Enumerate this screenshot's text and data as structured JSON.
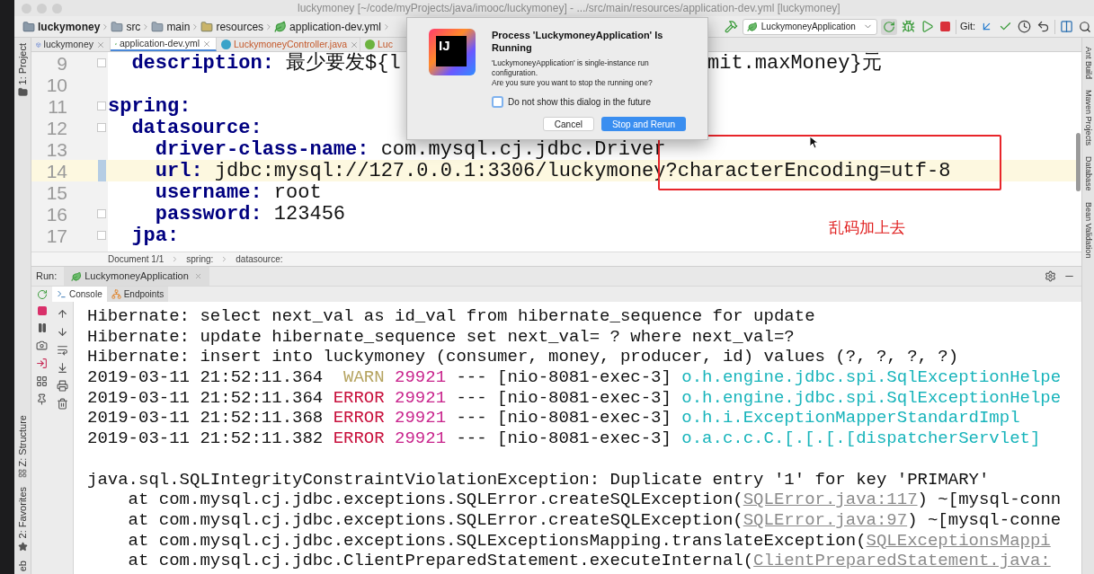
{
  "window": {
    "title": "luckymoney [~/code/myProjects/java/imooc/luckymoney] - .../src/main/resources/application-dev.yml [luckymoney]"
  },
  "breadcrumb": [
    {
      "label": "luckymoney",
      "kind": "project"
    },
    {
      "label": "src",
      "kind": "folder"
    },
    {
      "label": "main",
      "kind": "folder"
    },
    {
      "label": "resources",
      "kind": "resources"
    },
    {
      "label": "application-dev.yml",
      "kind": "yaml"
    }
  ],
  "toolbar": {
    "run_config": "LuckymoneyApplication",
    "git_label": "Git:"
  },
  "left_tool_windows": [
    "1: Project",
    "Z: Structure",
    "2: Favorites",
    "eb"
  ],
  "right_tool_windows": [
    "Ant Build",
    "Maven Projects",
    "Database",
    "Bean Validation"
  ],
  "tabs": [
    {
      "label": "luckymoney",
      "kind": "module",
      "selected": false,
      "error": false
    },
    {
      "label": "application-dev.yml",
      "kind": "yaml",
      "selected": true,
      "error": false
    },
    {
      "label": "LuckymoneyController.java",
      "kind": "class",
      "selected": false,
      "error": true
    },
    {
      "label": "Luc",
      "kind": "interface",
      "selected": false,
      "error": true
    }
  ],
  "editor": {
    "lines": [
      {
        "number": "9",
        "key": "  description:",
        "value": " 最少要发${l",
        "tail": "mit.maxMoney}元",
        "fold": true,
        "current": false
      },
      {
        "number": "10",
        "fold": false,
        "current": false
      },
      {
        "number": "11",
        "key": "spring:",
        "fold": true,
        "current": false
      },
      {
        "number": "12",
        "key": "  datasource:",
        "fold": true,
        "current": false
      },
      {
        "number": "13",
        "key": "    driver-class-name:",
        "value": " com.mysql.cj.jdbc.Driver",
        "fold": false,
        "current": false
      },
      {
        "number": "14",
        "key": "    url:",
        "value": " jdbc:mysql://127.0.0.1:3306/luckymoney",
        "boxed": "?characterEncoding=utf-8",
        "fold": false,
        "current": true
      },
      {
        "number": "15",
        "key": "    username:",
        "value": " root",
        "fold": false,
        "current": false
      },
      {
        "number": "16",
        "key": "    password:",
        "value": " 123456",
        "fold": true,
        "current": false
      },
      {
        "number": "17",
        "key": "  jpa:",
        "fold": true,
        "current": false
      }
    ]
  },
  "annotation": {
    "note": "乱码加上去"
  },
  "editor_breadcrumb": [
    "Document 1/1",
    "spring:",
    "datasource:"
  ],
  "run": {
    "label": "Run:",
    "tab": "LuckymoneyApplication",
    "console_tabs": [
      {
        "label": "Console",
        "kind": "console",
        "selected": true
      },
      {
        "label": "Endpoints",
        "kind": "endpoints",
        "selected": false
      }
    ],
    "lines": [
      {
        "kind": "plain",
        "text": "Hibernate: select next_val as id_val from hibernate_sequence for update"
      },
      {
        "kind": "plain",
        "text": "Hibernate: update hibernate_sequence set next_val= ? where next_val=?"
      },
      {
        "kind": "plain",
        "text": "Hibernate: insert into luckymoney (consumer, money, producer, id) values (?, ?, ?, ?)"
      },
      {
        "kind": "log",
        "timestamp": "2019-03-11 21:52:11.364",
        "level": "WARN",
        "color": "#b5a35f",
        "pid": "29921",
        "thread": "--- [nio-8081-exec-3]",
        "logger": "o.h.engine.jdbc.spi.SqlExceptionHelpe"
      },
      {
        "kind": "log",
        "timestamp": "2019-03-11 21:52:11.364",
        "level": "ERROR",
        "color": "#c8103c",
        "pid": "29921",
        "thread": "--- [nio-8081-exec-3]",
        "logger": "o.h.engine.jdbc.spi.SqlExceptionHelpe"
      },
      {
        "kind": "log",
        "timestamp": "2019-03-11 21:52:11.368",
        "level": "ERROR",
        "color": "#c8103c",
        "pid": "29921",
        "thread": "--- [nio-8081-exec-3]",
        "logger": "o.h.i.ExceptionMapperStandardImpl"
      },
      {
        "kind": "log",
        "timestamp": "2019-03-11 21:52:11.382",
        "level": "ERROR",
        "color": "#c8103c",
        "pid": "29921",
        "thread": "--- [nio-8081-exec-3]",
        "logger": "o.a.c.c.C.[.[.[.[dispatcherServlet]"
      },
      {
        "kind": "blank"
      },
      {
        "kind": "exception",
        "text": "java.sql.SQLIntegrityConstraintViolationException: Duplicate entry '1' for key 'PRIMARY'",
        "frames": [
          {
            "text": "at com.mysql.cj.jdbc.exceptions.SQLError.createSQLException(",
            "link": "SQLError.java:117",
            "suffix": ") ~[mysql-conn"
          },
          {
            "text": "at com.mysql.cj.jdbc.exceptions.SQLError.createSQLException(",
            "link": "SQLError.java:97",
            "suffix": ") ~[mysql-conne"
          },
          {
            "text": "at com.mysql.cj.jdbc.exceptions.SQLExceptionsMapping.translateException(",
            "link": "SQLExceptionsMappi"
          },
          {
            "text": "at com.mysql.cj.jdbc.ClientPreparedStatement.executeInternal(",
            "link": "ClientPreparedStatement.java:"
          }
        ]
      }
    ]
  },
  "dialog": {
    "logo": "IJ",
    "title": "Process 'LuckymoneyApplication' Is Running",
    "message": "'LuckymoneyApplication' is single-instance run configuration.",
    "question": "Are you sure you want to stop the running one?",
    "checkbox": {
      "label": "Do not show this dialog in the future",
      "checked": false
    },
    "buttons": [
      {
        "label": "Cancel",
        "default": false
      },
      {
        "label": "Stop and Rerun",
        "default": true
      }
    ]
  }
}
